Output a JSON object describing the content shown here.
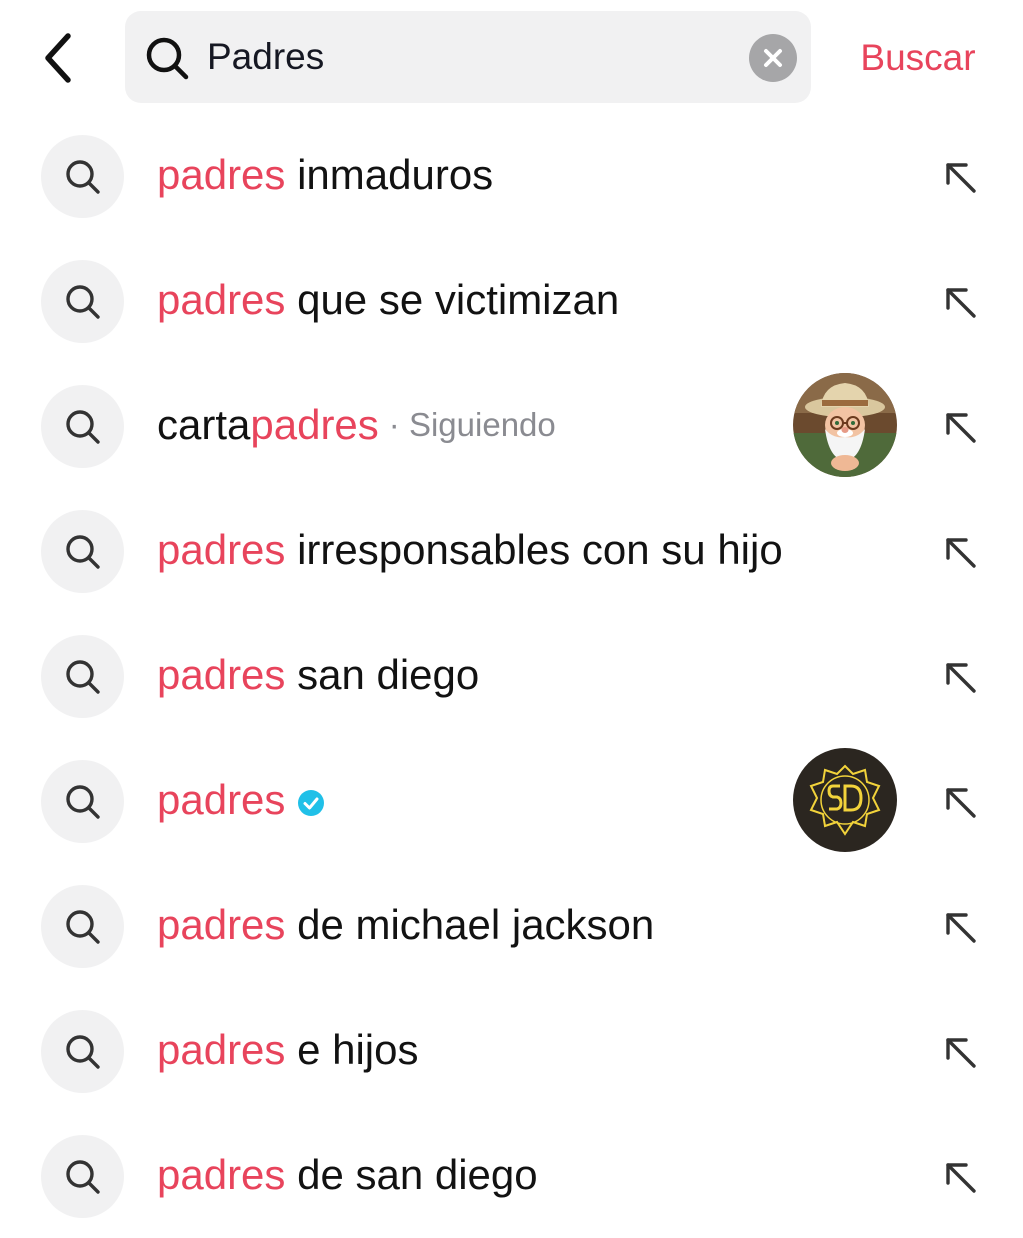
{
  "header": {
    "back_icon": "chevron-left-icon",
    "search_value": "Padres",
    "search_icon": "search-icon",
    "clear_icon": "clear-icon",
    "submit_label": "Buscar"
  },
  "suggestions": [
    {
      "highlight": "padres",
      "rest": " inmaduros"
    },
    {
      "highlight": "padres",
      "rest": " que se victimizan"
    },
    {
      "prefix": "carta",
      "highlight": "padres",
      "meta": "· Siguiendo",
      "avatar": "cartoon-grandpa-avatar"
    },
    {
      "highlight": "padres",
      "rest": " irresponsables con su hijo"
    },
    {
      "highlight": "padres",
      "rest": " san diego"
    },
    {
      "highlight": "padres",
      "verified": true,
      "avatar": "sd-padres-logo-avatar"
    },
    {
      "highlight": "padres",
      "rest": " de michael jackson"
    },
    {
      "highlight": "padres",
      "rest": " e hijos"
    },
    {
      "highlight": "padres",
      "rest": " de san diego"
    }
  ],
  "colors": {
    "accent": "#e8445c",
    "text": "#121212",
    "muted": "#8a8b91",
    "verified": "#20c0e8",
    "chip_bg": "#f1f1f2"
  }
}
